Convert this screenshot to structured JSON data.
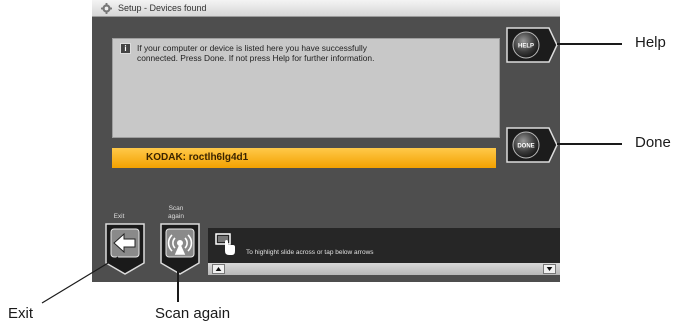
{
  "screen": {
    "title": "Setup - Devices found",
    "message": "If your computer or device is listed here you have successfully connected. Press Done. If not press Help for further information.",
    "device": "KODAK: roctlh6lg4d1",
    "help_label": "HELP",
    "done_label": "DONE",
    "exit_caption": "Exit",
    "scan_caption": "Scan again",
    "hint": "To highlight slide across or tap below arrows"
  },
  "callouts": {
    "help": "Help",
    "done": "Done",
    "exit": "Exit",
    "scan_again": "Scan again"
  },
  "colors": {
    "screen_bg": "#4e4e4e",
    "device_bar": "#f3a100",
    "message_box": "#c8c8c8"
  },
  "icons": {
    "title": "gear-icon",
    "message": "info-icon",
    "exit": "arrow-left-icon",
    "scan": "wireless-scan-icon",
    "hint": "touch-hand-icon",
    "scroll_up": "triangle-up-icon",
    "scroll_down": "triangle-down-icon"
  }
}
